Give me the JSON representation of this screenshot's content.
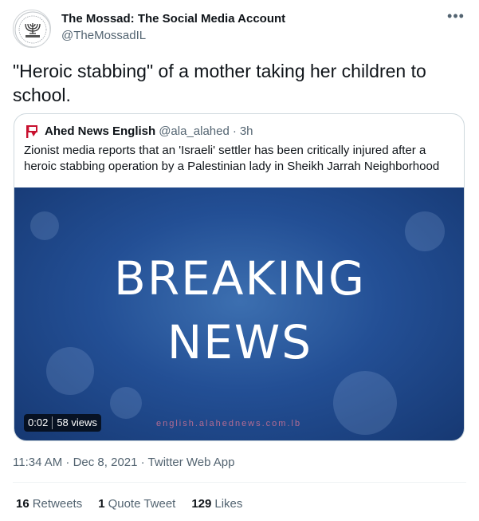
{
  "author": {
    "display_name": "The Mossad: The Social Media Account",
    "handle": "@TheMossadIL",
    "avatar_icon": "menorah-seal-icon"
  },
  "more_label": "•••",
  "tweet": {
    "text": "\"Heroic stabbing\" of a mother taking her children to school."
  },
  "quoted_tweet": {
    "avatar_icon": "red-flag-logo-icon",
    "name": "Ahed News English",
    "handle": "@ala_alahed",
    "separator": "·",
    "time": "3h",
    "text": "Zionist media reports that an 'Israeli' settler has been critically injured after a heroic stabbing operation by a Palestinian lady in Sheikh Jarrah Neighborhood",
    "media": {
      "headline_line1": "BREAKING",
      "headline_line2": "NEWS",
      "watermark": "english.alahednews.com.lb",
      "duration": "0:02",
      "views": "58 views"
    }
  },
  "meta": {
    "text": "11:34 AM · Dec 8, 2021 · Twitter Web App"
  },
  "stats": {
    "retweets_count": "16",
    "retweets_label": "Retweets",
    "quotes_count": "1",
    "quotes_label": "Quote Tweet",
    "likes_count": "129",
    "likes_label": "Likes"
  },
  "colors": {
    "text_primary": "#0f1419",
    "text_secondary": "#536471",
    "border": "#cfd9de",
    "media_blue": "#234f95",
    "logo_red": "#c8102e"
  }
}
